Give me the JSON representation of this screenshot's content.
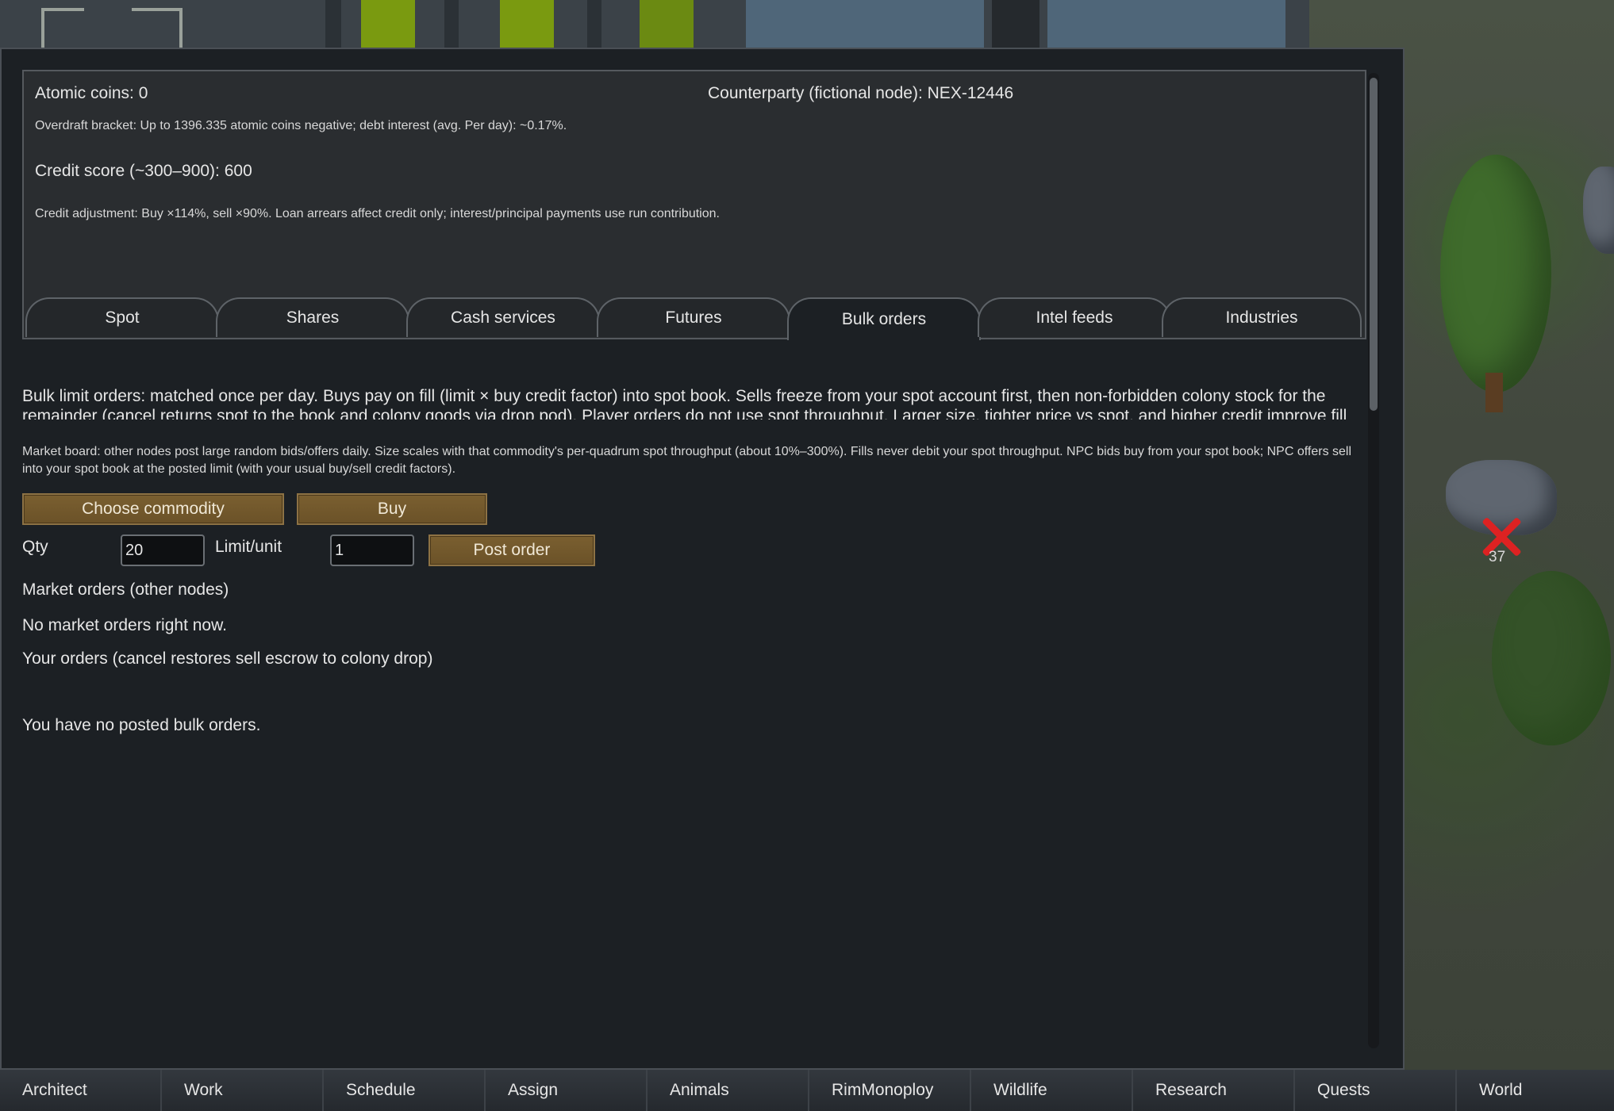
{
  "info": {
    "atomic_coins": "Atomic coins: 0",
    "counterparty": "Counterparty (fictional node): NEX-12446",
    "overdraft": "Overdraft bracket: Up to 1396.335 atomic coins negative; debt interest (avg. Per day): ~0.17%.",
    "credit_score": "Credit score (~300–900): 600",
    "credit_adjustment": "Credit adjustment: Buy ×114%, sell ×90%. Loan arrears affect credit only; interest/principal payments use run contribution."
  },
  "tabs": [
    {
      "label": "Spot"
    },
    {
      "label": "Shares"
    },
    {
      "label": "Cash services"
    },
    {
      "label": "Futures"
    },
    {
      "label": "Bulk orders",
      "active": true
    },
    {
      "label": "Intel feeds"
    },
    {
      "label": "Industries"
    }
  ],
  "bulk": {
    "description": "Bulk limit orders: matched once per day. Buys pay on fill (limit × buy credit factor) into spot book. Sells freeze from your spot account first, then non-forbidden colony stock for the remainder (cancel returns spot to the book and colony goods via drop pod). Player orders do not use spot throughput. Larger size, tighter price vs spot, and higher credit improve fill odds.",
    "board_note": "Market board: other nodes post large random bids/offers daily. Size scales with that commodity's per-quadrum spot throughput (about 10%–300%). Fills never debit your spot throughput. NPC bids buy from your spot book; NPC offers sell into your spot book at the posted limit (with your usual buy/sell credit factors).",
    "choose_commodity": "Choose commodity",
    "side": "Buy",
    "qty_label": "Qty",
    "qty_value": "20",
    "limit_label": "Limit/unit",
    "limit_value": "1",
    "post_order": "Post order",
    "market_orders_header": "Market orders (other nodes)",
    "market_orders_empty": "No market orders right now.",
    "your_orders_header": "Your orders (cancel restores sell escrow to colony drop)",
    "your_orders_empty": "You have no posted bulk orders."
  },
  "map": {
    "marker_count": "37"
  },
  "bottom_bar": [
    "Architect",
    "Work",
    "Schedule",
    "Assign",
    "Animals",
    "RimMonoploy",
    "Wildlife",
    "Research",
    "Quests",
    "World"
  ]
}
